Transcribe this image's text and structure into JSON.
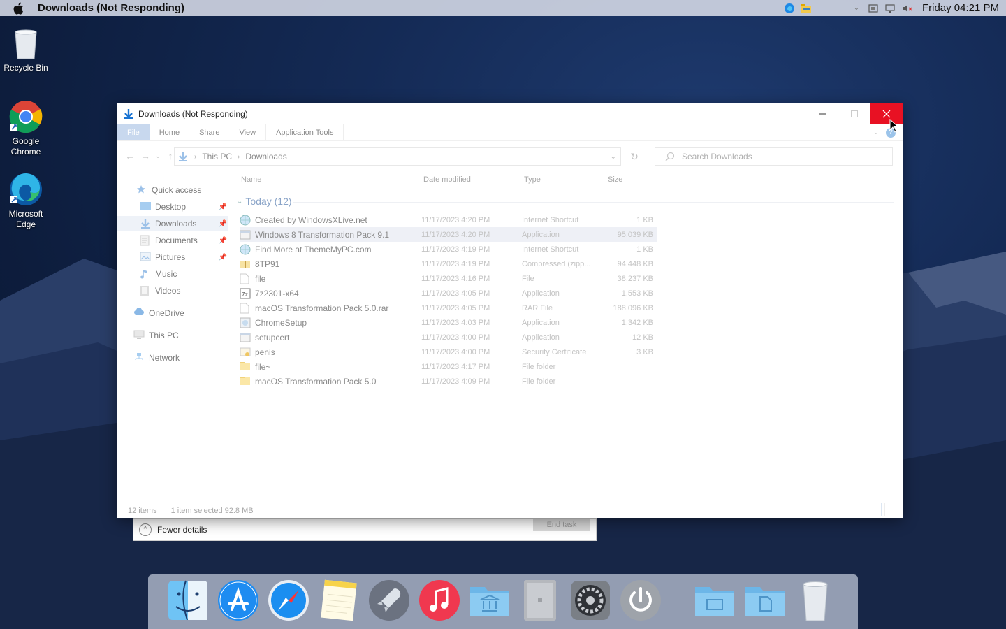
{
  "menubar": {
    "app_title": "Downloads (Not Responding)",
    "clock": "Friday 04:21 PM",
    "tray_icons": [
      "edge-icon",
      "file-explorer-icon",
      "chevron-down-icon",
      "task-view-icon",
      "network-icon",
      "volume-muted-icon"
    ]
  },
  "desktop": {
    "icons": [
      {
        "label": "Recycle Bin",
        "icon": "recycle-bin-icon"
      },
      {
        "label": "Google Chrome",
        "icon": "chrome-icon"
      },
      {
        "label": "Microsoft Edge",
        "icon": "edge-icon"
      }
    ]
  },
  "explorer": {
    "title": "Downloads (Not Responding)",
    "ribbon_tabs": [
      "File",
      "Home",
      "Share",
      "View",
      "Application Tools"
    ],
    "breadcrumb": [
      "This PC",
      "Downloads"
    ],
    "search_placeholder": "Search Downloads",
    "nav": {
      "quick_access": "Quick access",
      "items": [
        {
          "label": "Desktop",
          "pinned": true
        },
        {
          "label": "Downloads",
          "pinned": true,
          "selected": true
        },
        {
          "label": "Documents",
          "pinned": true
        },
        {
          "label": "Pictures",
          "pinned": true
        },
        {
          "label": "Music",
          "pinned": false
        },
        {
          "label": "Videos",
          "pinned": false
        }
      ],
      "onedrive": "OneDrive",
      "this_pc": "This PC",
      "network": "Network"
    },
    "columns": {
      "name": "Name",
      "date": "Date modified",
      "type": "Type",
      "size": "Size"
    },
    "group_label": "Today (12)",
    "files": [
      {
        "name": "Created by WindowsXLive.net",
        "date": "11/17/2023 4:20 PM",
        "type": "Internet Shortcut",
        "size": "1 KB",
        "icon": "internet-shortcut-icon"
      },
      {
        "name": "Windows 8 Transformation Pack 9.1",
        "date": "11/17/2023 4:20 PM",
        "type": "Application",
        "size": "95,039 KB",
        "icon": "application-icon",
        "selected": true
      },
      {
        "name": "Find More at ThemeMyPC.com",
        "date": "11/17/2023 4:19 PM",
        "type": "Internet Shortcut",
        "size": "1 KB",
        "icon": "internet-shortcut-icon"
      },
      {
        "name": "8TP91",
        "date": "11/17/2023 4:19 PM",
        "type": "Compressed (zipp...",
        "size": "94,448 KB",
        "icon": "zip-folder-icon"
      },
      {
        "name": "file",
        "date": "11/17/2023 4:16 PM",
        "type": "File",
        "size": "38,237 KB",
        "icon": "file-icon"
      },
      {
        "name": "7z2301-x64",
        "date": "11/17/2023 4:05 PM",
        "type": "Application",
        "size": "1,553 KB",
        "icon": "7zip-icon"
      },
      {
        "name": "macOS Transformation Pack 5.0.rar",
        "date": "11/17/2023 4:05 PM",
        "type": "RAR File",
        "size": "188,096 KB",
        "icon": "file-icon"
      },
      {
        "name": "ChromeSetup",
        "date": "11/17/2023 4:03 PM",
        "type": "Application",
        "size": "1,342 KB",
        "icon": "chrome-setup-icon"
      },
      {
        "name": "setupcert",
        "date": "11/17/2023 4:00 PM",
        "type": "Application",
        "size": "12 KB",
        "icon": "application-icon"
      },
      {
        "name": "penis",
        "date": "11/17/2023 4:00 PM",
        "type": "Security Certificate",
        "size": "3 KB",
        "icon": "certificate-icon"
      },
      {
        "name": "file~",
        "date": "11/17/2023 4:17 PM",
        "type": "File folder",
        "size": "",
        "icon": "folder-icon"
      },
      {
        "name": "macOS Transformation Pack 5.0",
        "date": "11/17/2023 4:09 PM",
        "type": "File folder",
        "size": "",
        "icon": "folder-icon"
      }
    ],
    "status": {
      "count": "12 items",
      "selection": "1 item selected  92.8 MB"
    }
  },
  "task_manager": {
    "fewer_details": "Fewer details",
    "end_task": "End task"
  },
  "dock": {
    "items": [
      "finder-icon",
      "app-store-icon",
      "safari-icon",
      "notes-icon",
      "launchpad-icon",
      "music-icon",
      "applications-folder-icon",
      "mac-pro-icon",
      "system-preferences-icon",
      "power-icon",
      "folder-icon",
      "documents-folder-icon",
      "trash-icon"
    ]
  },
  "colors": {
    "close_button": "#e81123",
    "accent": "#0078d7",
    "desktop_bg": "#142a55"
  }
}
